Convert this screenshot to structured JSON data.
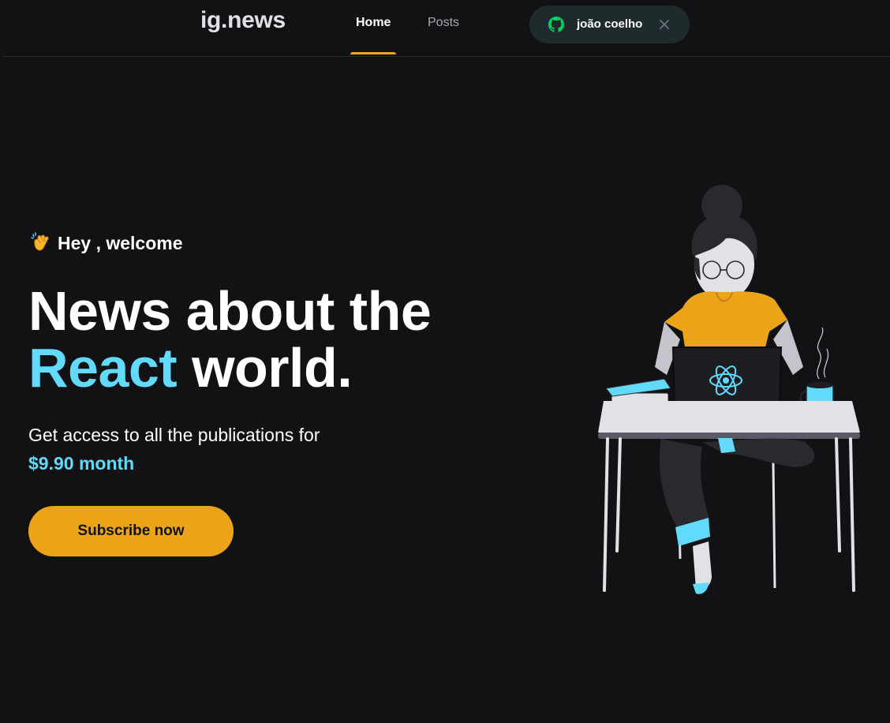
{
  "header": {
    "logo": "ig.news",
    "nav": {
      "home_label": "Home",
      "posts_label": "Posts"
    },
    "user": {
      "name": "joão coelho",
      "provider_icon": "github-icon",
      "sign_out_icon": "close-icon"
    }
  },
  "hero": {
    "greeting_emoji": "clapping-hands-icon",
    "greeting": "Hey , welcome",
    "title_line1": "News about the",
    "title_accent": "React",
    "title_rest": " world.",
    "description": "Get access to all the publications for",
    "price": "$9.90 month",
    "subscribe_label": "Subscribe now"
  },
  "colors": {
    "background": "#121214",
    "accent_yellow": "#eba417",
    "accent_cyan": "#61dafb",
    "text": "#ffffff",
    "muted": "#a8a8b3"
  }
}
